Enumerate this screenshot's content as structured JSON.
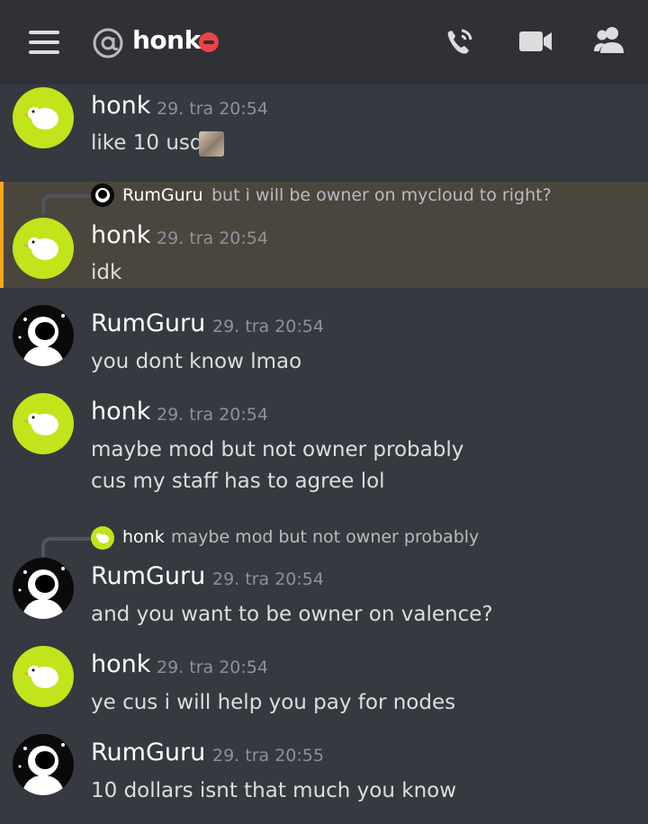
{
  "header": {
    "title": "honk",
    "icons": [
      "menu-icon",
      "at-icon",
      "dnd-status-icon",
      "voice-call-icon",
      "video-call-icon",
      "members-icon"
    ]
  },
  "messages": [
    {
      "user": "honk",
      "time": "29. tra 20:54",
      "lines": [
        "like 10 usd"
      ]
    },
    {
      "reply": {
        "user": "RumGuru",
        "text": "but i will be owner on mycloud to right?"
      },
      "user": "honk",
      "time": "29. tra 20:54",
      "lines": [
        "idk"
      ]
    },
    {
      "user": "RumGuru",
      "time": "29. tra 20:54",
      "lines": [
        "you dont know lmao"
      ]
    },
    {
      "user": "honk",
      "time": "29. tra 20:54",
      "lines": [
        "maybe mod but not owner probably",
        "cus my staff has to agree lol"
      ]
    },
    {
      "reply": {
        "user": "honk",
        "text": "maybe mod but not owner probably"
      },
      "user": "RumGuru",
      "time": "29. tra 20:54",
      "lines": [
        "and you want to be owner on valence?"
      ]
    },
    {
      "user": "honk",
      "time": "29. tra 20:54",
      "lines": [
        "ye cus i will help you pay for nodes"
      ]
    },
    {
      "user": "RumGuru",
      "time": "29. tra 20:55",
      "lines": [
        "10 dollars isnt that much you know"
      ]
    }
  ],
  "colors": {
    "background": "#36393f",
    "header": "#2f3136",
    "mention_highlight": "#4a463e",
    "mention_bar": "#faa61a",
    "dnd": "#ed4245",
    "honk_avatar": "#c2e41a"
  }
}
